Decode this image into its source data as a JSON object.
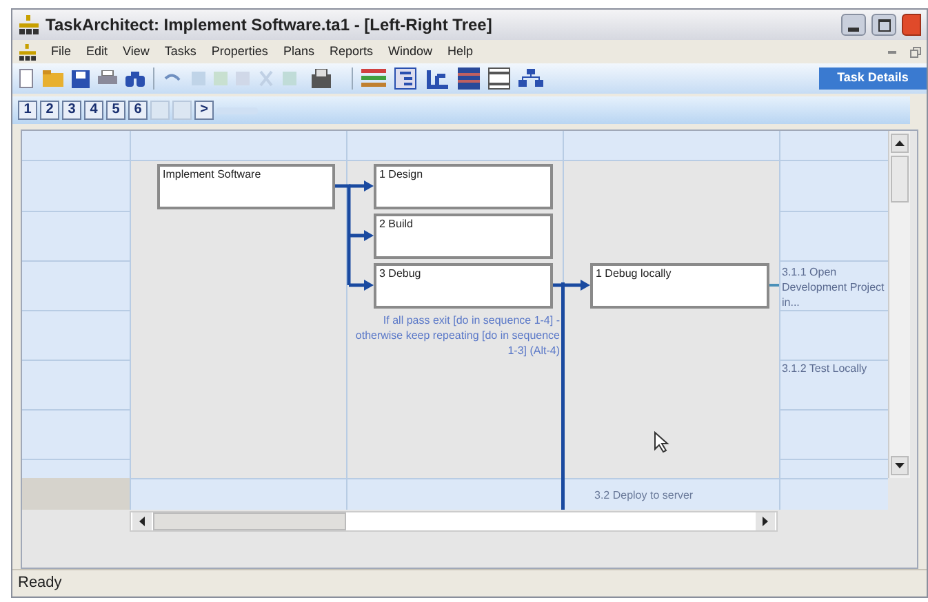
{
  "window": {
    "title": "TaskArchitect: Implement Software.ta1 - [Left-Right Tree]"
  },
  "menu": {
    "items": [
      "File",
      "Edit",
      "View",
      "Tasks",
      "Properties",
      "Plans",
      "Reports",
      "Window",
      "Help"
    ]
  },
  "task_details_button": "Task Details",
  "level_buttons": [
    {
      "label": "1",
      "disabled": false
    },
    {
      "label": "2",
      "disabled": false
    },
    {
      "label": "3",
      "disabled": false
    },
    {
      "label": "4",
      "disabled": false
    },
    {
      "label": "5",
      "disabled": false
    },
    {
      "label": "6",
      "disabled": false
    },
    {
      "label": ">",
      "disabled": false
    }
  ],
  "diagram": {
    "nodes": [
      {
        "label": "Implement Software"
      },
      {
        "label": "1 Design"
      },
      {
        "label": "2 Build"
      },
      {
        "label": "3 Debug"
      },
      {
        "label": "1 Debug locally"
      }
    ],
    "annotation": "If all pass exit [do in sequence 1-4] - otherwise keep repeating [do in sequence 1-3] (Alt-4)",
    "next_level": [
      "3.1.1 Open Development Project in...",
      "3.1.2 Test Locally"
    ],
    "bottom_task": "3.2 Deploy to server"
  },
  "status_bar": "Ready"
}
